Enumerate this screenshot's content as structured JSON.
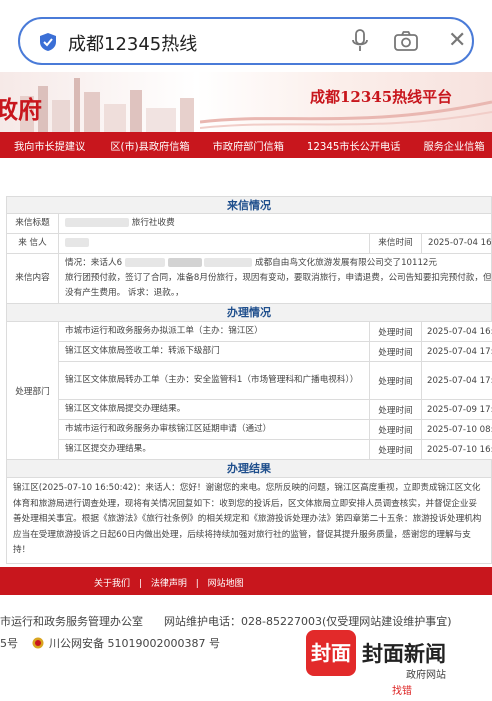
{
  "search": {
    "query": "成都12345热线",
    "icons": [
      "shield-check-icon",
      "mic-icon",
      "camera-icon",
      "close-icon"
    ]
  },
  "banner": {
    "left_title": "政府",
    "right_title": "成都12345热线平台"
  },
  "nav": [
    "我向市长提建议",
    "区(市)县政府信箱",
    "市政府部门信箱",
    "12345市长公开电话",
    "服务企业信箱"
  ],
  "letter": {
    "section_title": "来信情况",
    "title_label": "来信标题",
    "title_value": "旅行社收费",
    "sender_label": "来 信人",
    "time_label": "来信时间",
    "time_value": "2025-07-04 16:3",
    "content_label": "来信内容",
    "content_prefix": "情况：来话人6",
    "content_mid": "成都自由鸟文化旅游发展有限公司交了10112元",
    "content_line2": "旅行团预付款，签订了合同，准备8月份旅行，现因有变动，要取消旅行，申请退费，公司告知要扣完预付款，但开",
    "content_line3": "没有产生费用。 诉求：退款。，"
  },
  "process": {
    "section_title": "办理情况",
    "dept_label": "处理部门",
    "time_label": "处理时间",
    "steps": [
      {
        "text": "市城市运行和政务服务办拟派工单（主办：锦江区）",
        "time": "2025-07-04 16:3"
      },
      {
        "text": "锦江区文体旅局签收工单：转派下级部门",
        "time": "2025-07-04 17:0"
      },
      {
        "text": "锦江区文体旅局转办工单（主办：安全监管科1（市场管理科和广播电视科））",
        "time": "2025-07-04 17:0"
      },
      {
        "text": "锦江区文体旅局提交办理结果。",
        "time": "2025-07-09 17:0"
      },
      {
        "text": "市城市运行和政务服务办审核锦江区延期申请（通过）",
        "time": "2025-07-10 08:5"
      },
      {
        "text": "锦江区提交办理结果。",
        "time": "2025-07-10 16:5"
      }
    ]
  },
  "result": {
    "section_title": "办理结果",
    "text": "锦江区(2025-07-10 16:50:42)：来话人：您好！谢谢您的来电。您所反映的问题，锦江区高度重视，立即责成锦江区文化体育和旅游局进行调查处理，现将有关情况回复如下：收到您的投诉后，区文体旅局立即安排人员调查核实，并督促企业妥善处理相关事宜。根据《旅游法》《旅行社条例》的相关规定和《旅游投诉处理办法》第四章第二十五条：旅游投诉处理机构应当在受理旅游投诉之日起60日内做出处理，后续将持续加强对旅行社的监管，督促其提升服务质量，感谢您的理解与支持！"
  },
  "footer": {
    "links": [
      "关于我们",
      "|",
      "法律声明",
      "|",
      "网站地图"
    ],
    "org": "市运行和政务服务管理办公室",
    "maint": "网站维护电话：028-85227003(仅受理网站建设维护事宜)",
    "icp": "5号",
    "police": "川公网安备 51019002000387 号"
  },
  "watermark": {
    "logo": "封面",
    "brand": "封面新闻",
    "sub": "政府网站",
    "tag": "找错"
  },
  "colors": {
    "accent": "#c8161d",
    "heading": "#1e4e8c",
    "search_border": "#4a7bd8"
  }
}
